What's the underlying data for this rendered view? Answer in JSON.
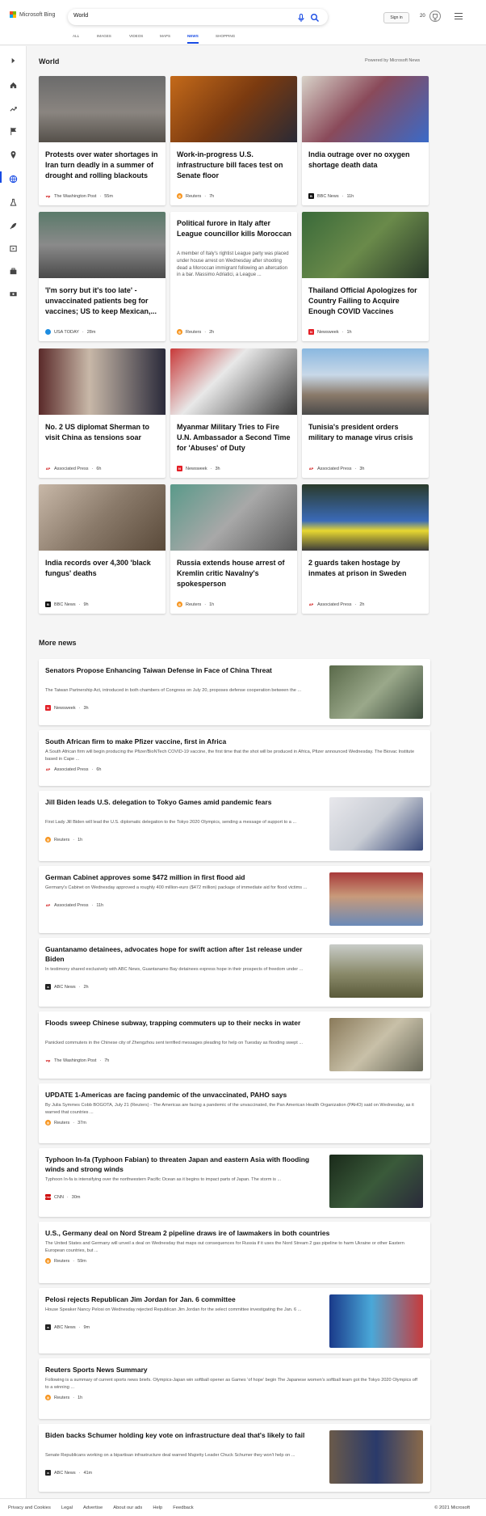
{
  "header": {
    "brand": "Microsoft Bing",
    "query": "World",
    "signin": "Sign in",
    "points": "20",
    "colors": {
      "accent": "#174ae4",
      "ms_red": "#f25022",
      "ms_green": "#7fba00",
      "ms_blue": "#00a4ef",
      "ms_yellow": "#ffb900"
    }
  },
  "tabs": [
    {
      "label": "ALL"
    },
    {
      "label": "IMAGES"
    },
    {
      "label": "VIDEOS"
    },
    {
      "label": "MAPS"
    },
    {
      "label": "NEWS"
    },
    {
      "label": "SHOPPING"
    }
  ],
  "sidebar_icons": [
    "expand-icon",
    "home-icon",
    "trending-icon",
    "flag-icon",
    "location-icon",
    "globe-icon",
    "science-icon",
    "rocket-icon",
    "movie-icon",
    "briefcase-icon",
    "money-icon"
  ],
  "world": {
    "title": "World",
    "powered": "Powered by Microsoft News",
    "cards": [
      {
        "title": "Protests over water shortages in Iran turn deadly in a summer of drought and rolling blackouts",
        "provider": "The Washington Post",
        "time": "55m",
        "snippet": ""
      },
      {
        "title": "Work-in-progress U.S. infrastructure bill faces test on Senate floor",
        "provider": "Reuters",
        "time": "7h",
        "snippet": ""
      },
      {
        "title": "India outrage over no oxygen shortage death data",
        "provider": "BBC News",
        "time": "11h",
        "snippet": ""
      },
      {
        "title": "'I'm sorry but it's too late' - unvaccinated patients beg for vaccines; US to keep Mexican,...",
        "provider": "USA TODAY",
        "time": "28m",
        "snippet": ""
      },
      {
        "title": "Political furore in Italy after League councillor kills Moroccan",
        "provider": "Reuters",
        "time": "2h",
        "snippet": "A member of Italy's rightist League party was placed under house arrest on Wednesday after shooting dead a Moroccan immigrant following an altercation in a bar. Massimo Adriatici, a League ..."
      },
      {
        "title": "Thailand Official Apologizes for Country Failing to Acquire Enough COVID Vaccines",
        "provider": "Newsweek",
        "time": "1h",
        "snippet": ""
      },
      {
        "title": "No. 2 US diplomat Sherman to visit China as tensions soar",
        "provider": "Associated Press",
        "time": "6h",
        "snippet": ""
      },
      {
        "title": "Myanmar Military Tries to Fire U.N. Ambassador a Second Time for 'Abuses' of Duty",
        "provider": "Newsweek",
        "time": "3h",
        "snippet": ""
      },
      {
        "title": "Tunisia's president orders military to manage virus crisis",
        "provider": "Associated Press",
        "time": "3h",
        "snippet": ""
      },
      {
        "title": "India records over 4,300 'black fungus' deaths",
        "provider": "BBC News",
        "time": "9h",
        "snippet": ""
      },
      {
        "title": "Russia extends house arrest of Kremlin critic Navalny's spokesperson",
        "provider": "Reuters",
        "time": "1h",
        "snippet": ""
      },
      {
        "title": "2 guards taken hostage by inmates at prison in Sweden",
        "provider": "Associated Press",
        "time": "2h",
        "snippet": ""
      }
    ]
  },
  "more": {
    "title": "More news",
    "items": [
      {
        "title": "Senators Propose Enhancing Taiwan Defense in Face of China Threat",
        "snippet": "The Taiwan Partnership Act, introduced in both chambers of Congress on July 20, proposes defense cooperation between the ...",
        "provider": "Newsweek",
        "time": "3h"
      },
      {
        "title": "South African firm to make Pfizer vaccine, first in Africa",
        "snippet": "A South African firm will begin producing the Pfizer/BioNTech COVID-19 vaccine, the first time that the shot will be produced in Africa, Pfizer announced Wednesday. The Biovac Institute based in Cape ...",
        "provider": "Associated Press",
        "time": "6h"
      },
      {
        "title": "Jill Biden leads U.S. delegation to Tokyo Games amid pandemic fears",
        "snippet": "First Lady Jill Biden will lead the U.S. diplomatic delegation to the Tokyo 2020 Olympics, sending a message of support to a ...",
        "provider": "Reuters",
        "time": "1h"
      },
      {
        "title": "German Cabinet approves some $472 million in first flood aid",
        "snippet": "Germany's Cabinet on Wednesday approved a roughly 400 million-euro ($472 million) package of immediate aid for flood victims ...",
        "provider": "Associated Press",
        "time": "11h"
      },
      {
        "title": "Guantanamo detainees, advocates hope for swift action after 1st release under Biden",
        "snippet": "In testimony shared exclusively with ABC News, Guantanamo Bay detainees express hope in their prospects of freedom under ...",
        "provider": "ABC News",
        "time": "2h"
      },
      {
        "title": "Floods sweep Chinese subway, trapping commuters up to their necks in water",
        "snippet": "Panicked commuters in the Chinese city of Zhengzhou sent terrified messages pleading for help on Tuesday as flooding swept ...",
        "provider": "The Washington Post",
        "time": "7h"
      },
      {
        "title": "UPDATE 1-Americas are facing pandemic of the unvaccinated, PAHO says",
        "snippet": "By Julia Symmes Cobb BOGOTA, July 21 (Reuters) - The Americas are facing a pandemic of the unvaccinated, the Pan American Health Organization (PAHO) said on Wednesday, as it warned that countries ...",
        "provider": "Reuters",
        "time": "37m"
      },
      {
        "title": "Typhoon In-fa (Typhoon Fabian) to threaten Japan and eastern Asia with flooding winds and strong winds",
        "snippet": "Typhoon In-fa is intensifying over the northwestern Pacific Ocean as it begins to impact parts of Japan. The storm is ...",
        "provider": "CNN",
        "time": "30m"
      },
      {
        "title": "U.S., Germany deal on Nord Stream 2 pipeline draws ire of lawmakers in both countries",
        "snippet": "The United States and Germany will unveil a deal on Wednesday that maps out consequences for Russia if it uses the Nord Stream 2 gas pipeline to harm Ukraine or other Eastern European countries, but ...",
        "provider": "Reuters",
        "time": "59m"
      },
      {
        "title": "Pelosi rejects Republican Jim Jordan for Jan. 6 committee",
        "snippet": "House Speaker Nancy Pelosi on Wednesday rejected Republican Jim Jordan for the select committee investigating the Jan. 6 ...",
        "provider": "ABC News",
        "time": "9m"
      },
      {
        "title": "Reuters Sports News Summary",
        "snippet": "Following is a summary of current sports news briefs. Olympics-Japan win softball opener as Games 'of hope' begin The Japanese women's softball team got the Tokyo 2020 Olympics off to a winning ...",
        "provider": "Reuters",
        "time": "1h"
      },
      {
        "title": "Biden backs Schumer holding key vote on infrastructure deal that's likely to fail",
        "snippet": "Senate Republicans working on a bipartisan infrastructure deal warned Majority Leader Chuck Schumer they won't help on ...",
        "provider": "ABC News",
        "time": "41m"
      }
    ]
  },
  "footer": {
    "links": [
      "Privacy and Cookies",
      "Legal",
      "Advertise",
      "About our ads",
      "Help",
      "Feedback"
    ],
    "copyright": "© 2021 Microsoft"
  }
}
